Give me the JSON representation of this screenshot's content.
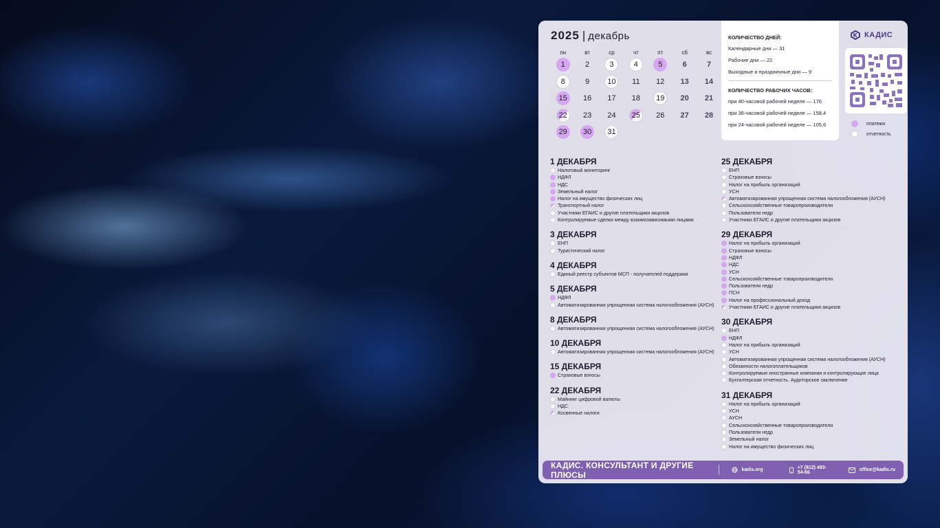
{
  "calendar": {
    "year": "2025",
    "separator": "|",
    "month": "декабрь",
    "weekdays": [
      "пн",
      "вт",
      "ср",
      "чт",
      "пт",
      "сб",
      "вс"
    ],
    "days": [
      {
        "n": "1",
        "s": "p"
      },
      {
        "n": "2",
        "s": ""
      },
      {
        "n": "3",
        "s": "o"
      },
      {
        "n": "4",
        "s": "o"
      },
      {
        "n": "5",
        "s": "p"
      },
      {
        "n": "6",
        "s": "w"
      },
      {
        "n": "7",
        "s": "w"
      },
      {
        "n": "8",
        "s": "o"
      },
      {
        "n": "9",
        "s": ""
      },
      {
        "n": "10",
        "s": "o"
      },
      {
        "n": "11",
        "s": ""
      },
      {
        "n": "12",
        "s": ""
      },
      {
        "n": "13",
        "s": "w"
      },
      {
        "n": "14",
        "s": "w"
      },
      {
        "n": "15",
        "s": "p"
      },
      {
        "n": "16",
        "s": ""
      },
      {
        "n": "17",
        "s": ""
      },
      {
        "n": "18",
        "s": ""
      },
      {
        "n": "19",
        "s": "o"
      },
      {
        "n": "20",
        "s": "w"
      },
      {
        "n": "21",
        "s": "w"
      },
      {
        "n": "22",
        "s": "h"
      },
      {
        "n": "23",
        "s": ""
      },
      {
        "n": "24",
        "s": ""
      },
      {
        "n": "25",
        "s": "h"
      },
      {
        "n": "26",
        "s": ""
      },
      {
        "n": "27",
        "s": "w"
      },
      {
        "n": "28",
        "s": "w"
      },
      {
        "n": "29",
        "s": "p"
      },
      {
        "n": "30",
        "s": "p"
      },
      {
        "n": "31",
        "s": "o"
      }
    ]
  },
  "info": {
    "days_title": "КОЛИЧЕСТВО ДНЕЙ:",
    "calendar_days": "Календарные дни — 31",
    "work_days": "Рабочие дни — 22",
    "holidays": "Выходные и праздничные дни — 9",
    "hours_title": "КОЛИЧЕСТВО РАБОЧИХ ЧАСОВ:",
    "h40": "при 40-часовой рабочей неделе — 176",
    "h36": "при 36-часовой рабочей неделе — 158,4",
    "h24": "при 24-часовой рабочей неделе — 105,6"
  },
  "brand": {
    "name": "КАДИС"
  },
  "legend": {
    "payments": "платежи",
    "reports": "отчетность"
  },
  "colors": {
    "accent": "#d7a6f1",
    "footer": "#7e5fb0",
    "brand": "#4a3a87"
  },
  "events_left": [
    {
      "date": "1 ДЕКАБРЯ",
      "items": [
        {
          "t": "Налоговый мониторинг",
          "s": "o"
        },
        {
          "t": "НДФЛ",
          "s": "p"
        },
        {
          "t": "НДС",
          "s": "p"
        },
        {
          "t": "Земельный налог",
          "s": "p"
        },
        {
          "t": "Налог на имущество физических лиц",
          "s": "p"
        },
        {
          "t": "Транспортный налог",
          "s": "h"
        },
        {
          "t": "Участники ЕГАИС и другие плательщики акцизов",
          "s": "o"
        },
        {
          "t": "Контролируемые сделки между взаимозависимыми лицами",
          "s": "o"
        }
      ]
    },
    {
      "date": "3 ДЕКАБРЯ",
      "items": [
        {
          "t": "ЕНП",
          "s": "o"
        },
        {
          "t": "Туристический налог",
          "s": "o"
        }
      ]
    },
    {
      "date": "4 ДЕКАБРЯ",
      "items": [
        {
          "t": "Единый реестр субъектов МСП - получателей поддержки",
          "s": "o"
        }
      ]
    },
    {
      "date": "5 ДЕКАБРЯ",
      "items": [
        {
          "t": "НДФЛ",
          "s": "p"
        },
        {
          "t": "Автоматизированная упрощенная система налогообложения (АУСН)",
          "s": "o"
        }
      ]
    },
    {
      "date": "8 ДЕКАБРЯ",
      "items": [
        {
          "t": "Автоматизированная упрощенная система налогообложения (АУСН)",
          "s": "o"
        }
      ]
    },
    {
      "date": "10 ДЕКАБРЯ",
      "items": [
        {
          "t": "Автоматизированная упрощенная система налогообложения (АУСН)",
          "s": "o"
        }
      ]
    },
    {
      "date": "15 ДЕКАБРЯ",
      "items": [
        {
          "t": "Страховые взносы",
          "s": "p"
        }
      ]
    },
    {
      "date": "22 ДЕКАБРЯ",
      "items": [
        {
          "t": "Майнинг цифровой валюты",
          "s": "o"
        },
        {
          "t": "НДС",
          "s": "o"
        },
        {
          "t": "Косвенные налоги",
          "s": "h"
        }
      ]
    }
  ],
  "events_right": [
    {
      "date": "25 ДЕКАБРЯ",
      "items": [
        {
          "t": "ЕНП",
          "s": "o"
        },
        {
          "t": "Страховые взносы",
          "s": "o"
        },
        {
          "t": "Налог на прибыль организаций",
          "s": "o"
        },
        {
          "t": "УСН",
          "s": "o"
        },
        {
          "t": "Автоматизированная упрощенная система налогообложения (АУСН)",
          "s": "h"
        },
        {
          "t": "Сельскохозяйственные товаропроизводители",
          "s": "o"
        },
        {
          "t": "Пользователи недр",
          "s": "o"
        },
        {
          "t": "Участники ЕГАИС и другие плательщики акцизов",
          "s": "o"
        }
      ]
    },
    {
      "date": "29 ДЕКАБРЯ",
      "items": [
        {
          "t": "Налог на прибыль организаций",
          "s": "p"
        },
        {
          "t": "Страховые взносы",
          "s": "p"
        },
        {
          "t": "НДФЛ",
          "s": "p"
        },
        {
          "t": "НДС",
          "s": "p"
        },
        {
          "t": "УСН",
          "s": "p"
        },
        {
          "t": "Сельскохозяйственные товаропроизводители",
          "s": "p"
        },
        {
          "t": "Пользователи недр",
          "s": "p"
        },
        {
          "t": "ПСН",
          "s": "p"
        },
        {
          "t": "Налог на профессиональный доход",
          "s": "p"
        },
        {
          "t": "Участники ЕГАИС и другие плательщики акцизов",
          "s": "h"
        }
      ]
    },
    {
      "date": "30 ДЕКАБРЯ",
      "items": [
        {
          "t": "ЕНП",
          "s": "o"
        },
        {
          "t": "НДФЛ",
          "s": "p"
        },
        {
          "t": "Налог на прибыль организаций",
          "s": "o"
        },
        {
          "t": "УСН",
          "s": "o"
        },
        {
          "t": "Автоматизированная упрощенная система налогообложения (АУСН)",
          "s": "o"
        },
        {
          "t": "Обязанности налогоплательщиков",
          "s": "o"
        },
        {
          "t": "Контролируемые иностранные компании и контролирующие лица",
          "s": "o"
        },
        {
          "t": "Бухгалтерская отчетность. Аудиторское заключение",
          "s": "o"
        }
      ]
    },
    {
      "date": "31 ДЕКАБРЯ",
      "items": [
        {
          "t": "Налог на прибыль организаций",
          "s": "o"
        },
        {
          "t": "УСН",
          "s": "o"
        },
        {
          "t": "АУСН",
          "s": "o"
        },
        {
          "t": "Сельскохозяйственные товаропроизводители",
          "s": "o"
        },
        {
          "t": "Пользователи недр",
          "s": "o"
        },
        {
          "t": "Земельный налог",
          "s": "o"
        },
        {
          "t": "Налог на имущество физических лиц",
          "s": "o"
        }
      ]
    }
  ],
  "footer": {
    "slogan": "КАДИС. КОНСУЛЬТАНТ И ДРУГИЕ ПЛЮСЫ",
    "site": "kadis.org",
    "phone": "+7 (812) 493-54-66",
    "email": "office@kadis.ru",
    "icons": [
      "globe-icon",
      "phone-icon",
      "mail-icon"
    ]
  }
}
